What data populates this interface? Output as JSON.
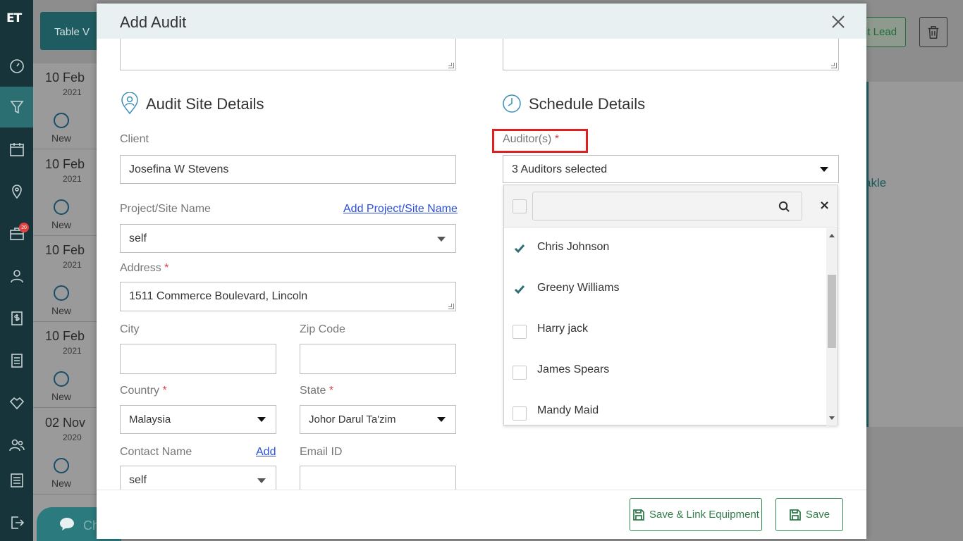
{
  "nav": {
    "logo": "ET",
    "badge": "20"
  },
  "background": {
    "table_view_label": "Table V",
    "edit_lead_label": "it Lead",
    "partial_text": "akle",
    "chat_label": "Ch",
    "items": [
      {
        "day": "10 Feb",
        "year": "2021",
        "status": "New"
      },
      {
        "day": "10 Feb",
        "year": "2021",
        "status": "New"
      },
      {
        "day": "10 Feb",
        "year": "2021",
        "status": "New"
      },
      {
        "day": "10 Feb",
        "year": "2021",
        "status": "New"
      },
      {
        "day": "02 Nov",
        "year": "2020",
        "status": "New"
      }
    ]
  },
  "modal": {
    "title": "Add Audit",
    "site": {
      "section_title": "Audit Site Details",
      "client_label": "Client",
      "client_value": "Josefina W Stevens",
      "project_label": "Project/Site Name",
      "add_project_link": "Add Project/Site Name",
      "project_value": "self",
      "address_label": "Address",
      "address_value": "1511  Commerce Boulevard, Lincoln",
      "city_label": "City",
      "city_value": "",
      "zip_label": "Zip Code",
      "zip_value": "",
      "country_label": "Country",
      "country_value": "Malaysia",
      "state_label": "State",
      "state_value": "Johor Darul Ta'zim",
      "contact_label": "Contact Name",
      "add_contact_link": "Add",
      "contact_value": "self",
      "email_label": "Email ID",
      "email_value": ""
    },
    "schedule": {
      "section_title": "Schedule Details",
      "auditors_label": "Auditor(s)",
      "required_mark": "*",
      "auditors_value": "3 Auditors selected",
      "search_placeholder": "",
      "close_symbol": "×",
      "options": [
        {
          "name": "Chris Johnson",
          "checked": true
        },
        {
          "name": "Greeny Williams",
          "checked": true
        },
        {
          "name": "Harry jack",
          "checked": false
        },
        {
          "name": "James Spears",
          "checked": false
        },
        {
          "name": "Mandy Maid",
          "checked": false
        }
      ]
    },
    "footer": {
      "save_link_label": "Save & Link Equipment",
      "save_label": "Save"
    }
  }
}
